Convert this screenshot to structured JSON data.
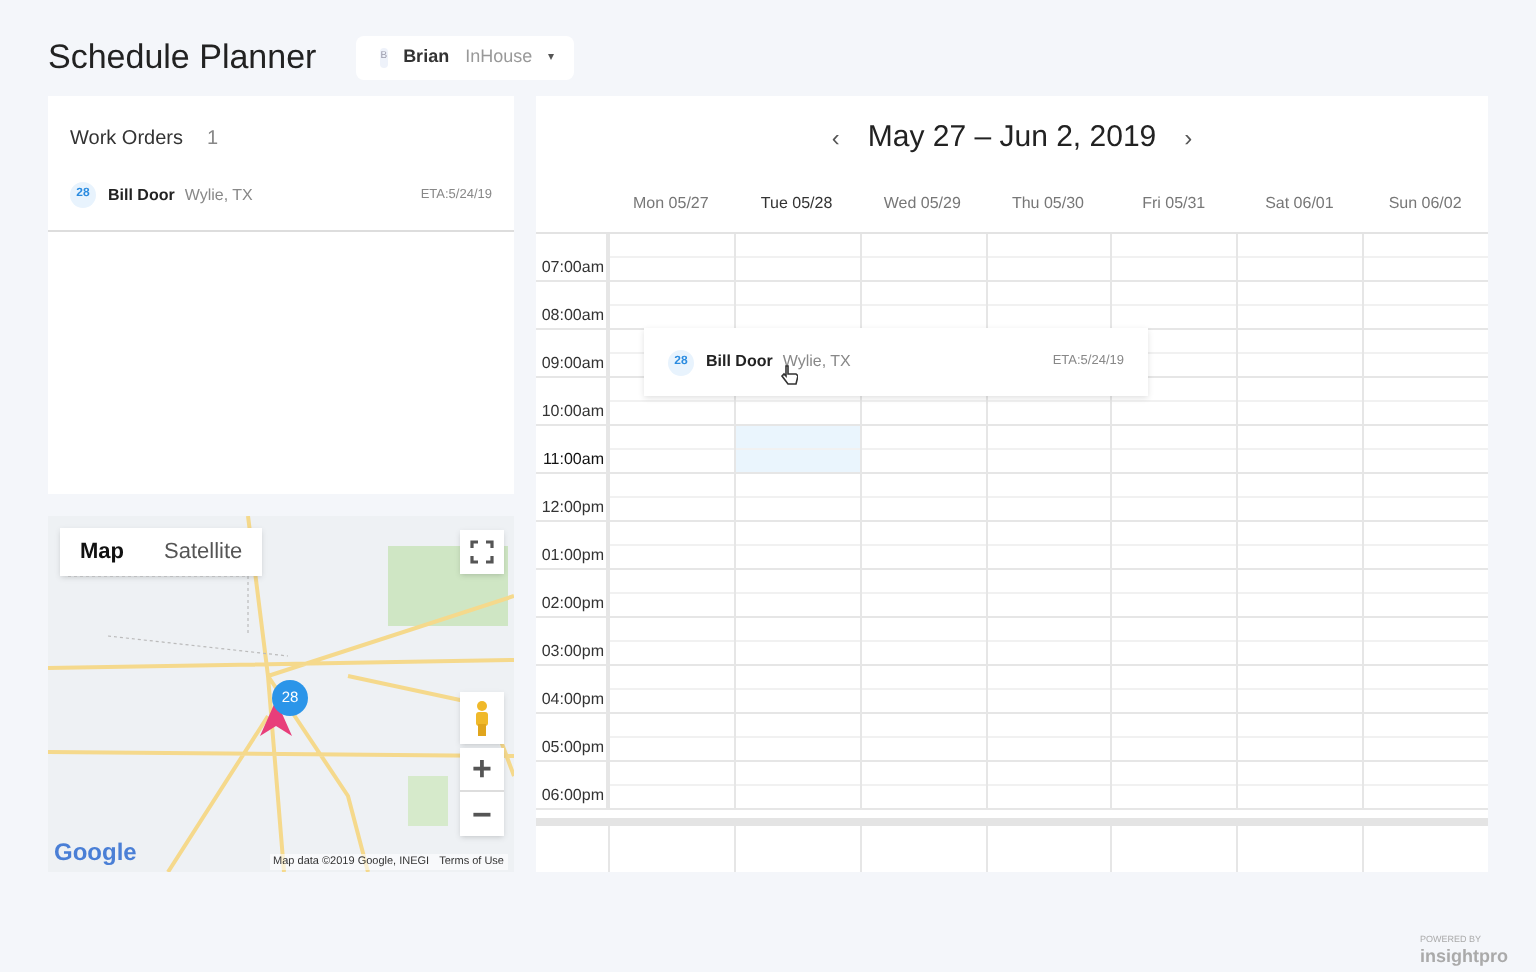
{
  "header": {
    "title": "Schedule Planner",
    "user": {
      "initial": "B",
      "name": "Brian",
      "team": "InHouse",
      "caret": "▾"
    }
  },
  "work_orders": {
    "title": "Work Orders",
    "count": "1",
    "items": [
      {
        "number": "28",
        "name": "Bill Door",
        "location": "Wylie, TX",
        "eta": "ETA:5/24/19"
      }
    ]
  },
  "map": {
    "tabs": [
      {
        "label": "Map",
        "selected": true
      },
      {
        "label": "Satellite",
        "selected": false
      }
    ],
    "marker": "28",
    "logo": "Google",
    "attribution": "Map data ©2019 Google, INEGI",
    "terms": "Terms of Use",
    "zoom_in": "+",
    "zoom_out": "−"
  },
  "calendar": {
    "prev": "‹",
    "range": "May 27 – Jun 2, 2019",
    "next": "›",
    "days": [
      {
        "label": "Mon 05/27",
        "drop_target": false
      },
      {
        "label": "Tue 05/28",
        "drop_target": true
      },
      {
        "label": "Wed 05/29",
        "drop_target": false
      },
      {
        "label": "Thu 05/30",
        "drop_target": false
      },
      {
        "label": "Fri 05/31",
        "drop_target": false
      },
      {
        "label": "Sat 06/01",
        "drop_target": false
      },
      {
        "label": "Sun 06/02",
        "drop_target": false
      }
    ],
    "times": [
      {
        "label": "07:00am",
        "drop_target": false
      },
      {
        "label": "08:00am",
        "drop_target": false
      },
      {
        "label": "09:00am",
        "drop_target": false
      },
      {
        "label": "10:00am",
        "drop_target": false
      },
      {
        "label": "11:00am",
        "drop_target": true
      },
      {
        "label": "12:00pm",
        "drop_target": false
      },
      {
        "label": "01:00pm",
        "drop_target": false
      },
      {
        "label": "02:00pm",
        "drop_target": false
      },
      {
        "label": "03:00pm",
        "drop_target": false
      },
      {
        "label": "04:00pm",
        "drop_target": false
      },
      {
        "label": "05:00pm",
        "drop_target": false
      },
      {
        "label": "06:00pm",
        "drop_target": false
      }
    ],
    "dragged_card": {
      "number": "28",
      "name": "Bill Door",
      "location": "Wylie, TX",
      "eta": "ETA:5/24/19"
    }
  },
  "footer": {
    "powered_by": "POWERED BY",
    "brand": "insightpro"
  }
}
